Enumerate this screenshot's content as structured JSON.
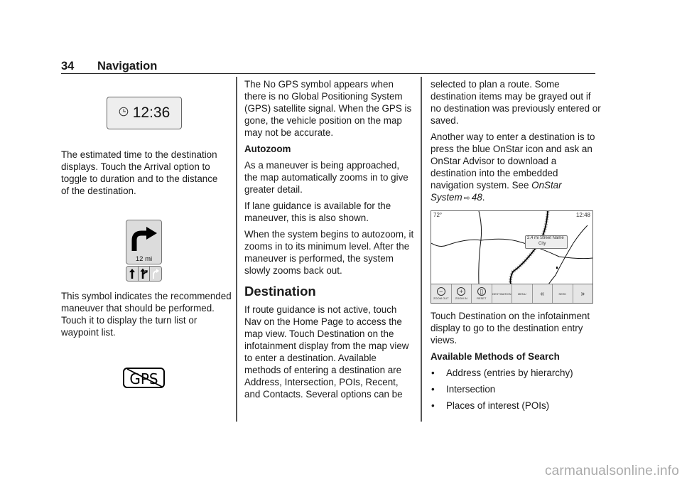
{
  "header": {
    "page_number": "34",
    "section_title": "Navigation"
  },
  "col1": {
    "clock_display": {
      "icon": "clock-icon",
      "time": "12:36"
    },
    "para1": "The estimated time to the destination displays. Touch the Arrival option to toggle to duration and to the distance of the destination.",
    "maneuver_symbol": {
      "icon": "turn-right-arrow-icon",
      "distance": "12 mi",
      "lanes": [
        "straight-lane-icon",
        "fork-right-lane-icon",
        "turn-right-lane-disabled-icon"
      ]
    },
    "para2": "This symbol indicates the recommended maneuver that should be performed. Touch it to display the turn list or waypoint list.",
    "no_gps_symbol": {
      "icon": "no-gps-icon",
      "text": "GPS"
    }
  },
  "col2": {
    "para1": "The No GPS symbol appears when there is no Global Positioning System (GPS) satellite signal. When the GPS is gone, the vehicle position on the map may not be accurate.",
    "autozoom_heading": "Autozoom",
    "para2": "As a maneuver is being approached, the map automatically zooms in to give greater detail.",
    "para3": "If lane guidance is available for the maneuver, this is also shown.",
    "para4": "When the system begins to autozoom, it zooms in to its minimum level. After the maneuver is performed, the system slowly zooms back out.",
    "destination_heading": "Destination",
    "para5": "If route guidance is not active, touch Nav on the Home Page to access the map view. Touch Destination on the infotainment display from the map view to enter a destination. Available methods of entering a destination are Address, Intersection, POIs, Recent, and Contacts. Several options can be"
  },
  "col3": {
    "para1": "selected to plan a route. Some destination items may be grayed out if no destination was previously entered or saved.",
    "para2_prefix": "Another way to enter a destination is to press the blue OnStar icon and ask an OnStar Advisor to download a destination into the embedded navigation system. See ",
    "para2_link": "OnStar System",
    "para2_ref_icon": "⇨",
    "para2_ref_page": "48",
    "para2_suffix": ".",
    "map_screen": {
      "temperature": "72°",
      "time": "12:48",
      "street_label": {
        "distance": "2.4 mi Street Name",
        "city": "City"
      },
      "toolbar": [
        {
          "label": "ZOOM OUT",
          "icon": "zoom-out-icon"
        },
        {
          "label": "ZOOM IN",
          "icon": "zoom-in-icon"
        },
        {
          "label": "RESET",
          "icon": "reset-icon"
        },
        {
          "label": "DESTINATION",
          "icon": ""
        },
        {
          "label": "MENU",
          "icon": ""
        },
        {
          "label": "",
          "icon": "seek-back-icon"
        },
        {
          "label": "SEEK",
          "icon": ""
        },
        {
          "label": "",
          "icon": "seek-forward-icon"
        }
      ]
    },
    "para3": "Touch Destination on the infotainment display to go to the destination entry views.",
    "methods_heading": "Available Methods of Search",
    "methods": [
      "Address (entries by hierarchy)",
      "Intersection",
      "Places of interest (POIs)"
    ],
    "bullet": "•"
  },
  "watermark": "carmanualsonline.info"
}
